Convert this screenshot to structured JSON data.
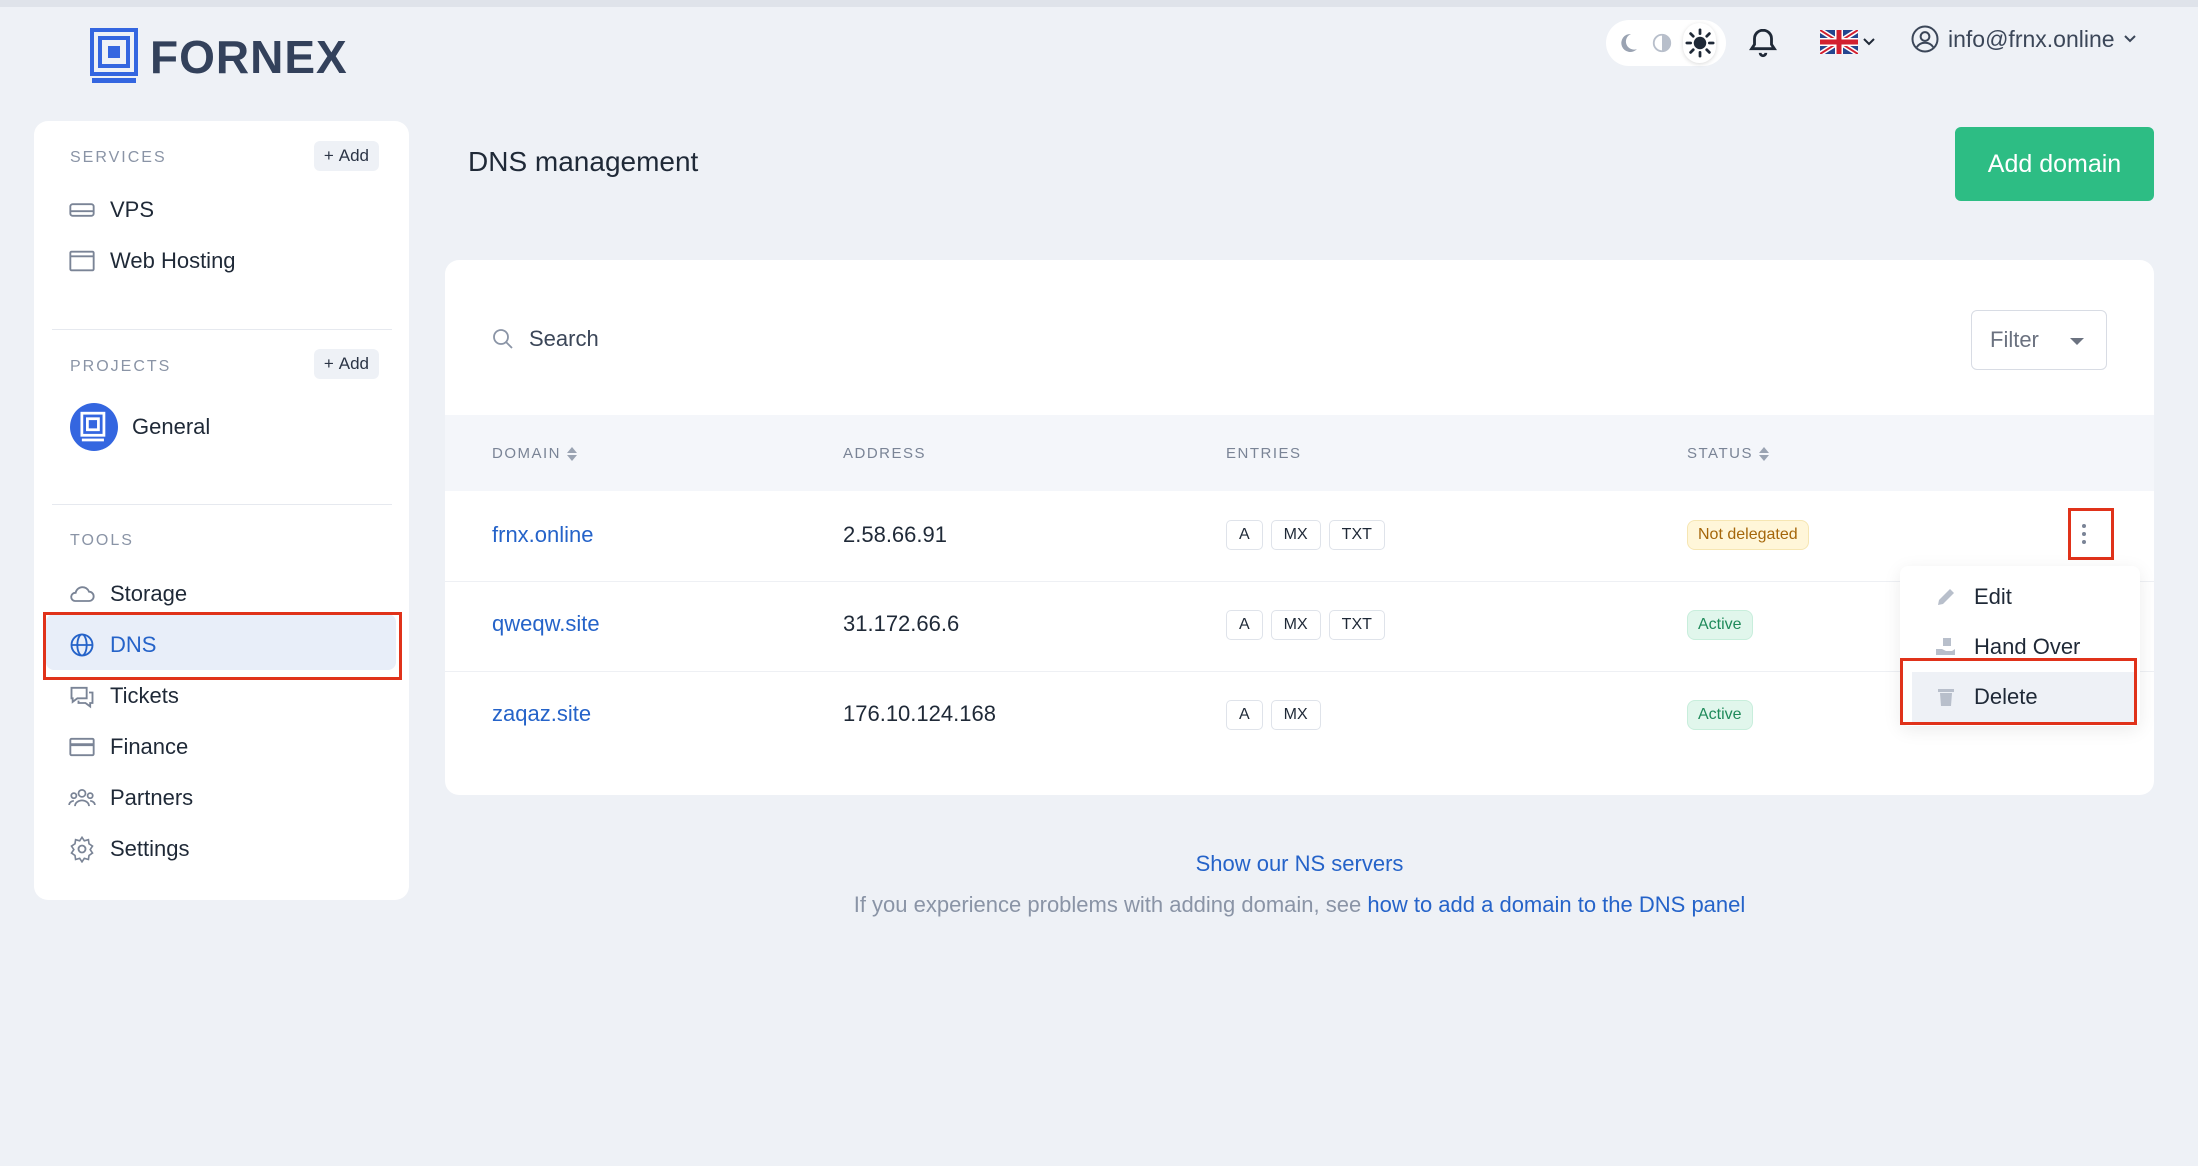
{
  "brand": {
    "name": "FORNEX"
  },
  "header": {
    "theme_icons": [
      "moon-icon",
      "contrast-icon",
      "sun-icon"
    ],
    "user_email": "info@frnx.online",
    "language": "en"
  },
  "sidebar": {
    "services": {
      "heading": "SERVICES",
      "add_label": "Add",
      "items": [
        {
          "label": "VPS",
          "icon": "server-icon"
        },
        {
          "label": "Web Hosting",
          "icon": "browser-window-icon"
        }
      ]
    },
    "projects": {
      "heading": "PROJECTS",
      "add_label": "Add",
      "items": [
        {
          "label": "General",
          "icon": "project-logo-icon"
        }
      ]
    },
    "tools": {
      "heading": "TOOLS",
      "items": [
        {
          "label": "Storage",
          "icon": "cloud-icon"
        },
        {
          "label": "DNS",
          "icon": "globe-icon",
          "active": true
        },
        {
          "label": "Tickets",
          "icon": "chat-icon"
        },
        {
          "label": "Finance",
          "icon": "card-icon"
        },
        {
          "label": "Partners",
          "icon": "people-icon"
        },
        {
          "label": "Settings",
          "icon": "gear-icon"
        }
      ]
    }
  },
  "main": {
    "title": "DNS management",
    "add_domain_label": "Add domain",
    "search_placeholder": "Search",
    "filter_label": "Filter",
    "columns": {
      "domain": "DOMAIN",
      "address": "ADDRESS",
      "entries": "ENTRIES",
      "status": "STATUS"
    },
    "rows": [
      {
        "domain": "frnx.online",
        "address": "2.58.66.91",
        "entries": [
          "A",
          "MX",
          "TXT"
        ],
        "status": "Not delegated",
        "status_kind": "warn"
      },
      {
        "domain": "qweqw.site",
        "address": "31.172.66.6",
        "entries": [
          "A",
          "MX",
          "TXT"
        ],
        "status": "Active",
        "status_kind": "ok"
      },
      {
        "domain": "zaqaz.site",
        "address": "176.10.124.168",
        "entries": [
          "A",
          "MX"
        ],
        "status": "Active",
        "status_kind": "ok"
      }
    ],
    "row_menu": {
      "items": [
        {
          "label": "Edit",
          "icon": "pencil-icon"
        },
        {
          "label": "Hand Over",
          "icon": "hand-over-icon"
        },
        {
          "label": "Delete",
          "icon": "trash-icon"
        }
      ]
    },
    "ns_link": "Show our NS servers",
    "help_text": "If you experience problems with adding domain, see",
    "help_link": "how to add a domain to the DNS panel"
  },
  "colors": {
    "accent": "#2dbd84",
    "link": "#2563c9",
    "highlight": "#e0321a",
    "background": "#eef1f6"
  }
}
